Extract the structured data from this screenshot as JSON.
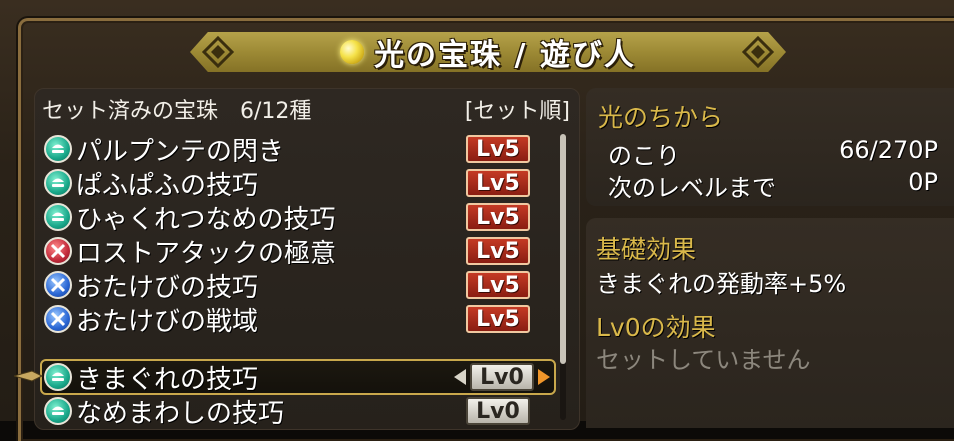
{
  "header": {
    "title": "光の宝珠 / 遊び人",
    "icon": "light-orb-icon"
  },
  "list": {
    "heading": "セット済みの宝珠　6/12種",
    "sort_label": "[セット順]",
    "rows": [
      {
        "name": "パルプンテの閃き",
        "level": "Lv5",
        "gem": "green",
        "icon": "green-gem-icon"
      },
      {
        "name": "ぱふぱふの技巧",
        "level": "Lv5",
        "gem": "green",
        "icon": "green-gem-icon"
      },
      {
        "name": "ひゃくれつなめの技巧",
        "level": "Lv5",
        "gem": "green",
        "icon": "green-gem-icon"
      },
      {
        "name": "ロストアタックの極意",
        "level": "Lv5",
        "gem": "red",
        "icon": "red-gem-icon"
      },
      {
        "name": "おたけびの技巧",
        "level": "Lv5",
        "gem": "blue",
        "icon": "blue-gem-icon"
      },
      {
        "name": "おたけびの戦域",
        "level": "Lv5",
        "gem": "blue",
        "icon": "blue-gem-icon"
      },
      {
        "name": "きまぐれの技巧",
        "level": "Lv0",
        "gem": "green",
        "icon": "green-gem-icon"
      },
      {
        "name": "なめまわしの技巧",
        "level": "Lv0",
        "gem": "green",
        "icon": "green-gem-icon"
      }
    ]
  },
  "power": {
    "title": "光のちから",
    "remaining_label": "のこり",
    "remaining_value": "66/270P",
    "next_label": "次のレベルまで",
    "next_value": "0P"
  },
  "effects": {
    "base_title": "基礎効果",
    "base_text": "きまぐれの発動率+5%",
    "level_title": "Lv0の効果",
    "level_text": "セットしていません"
  },
  "colors": {
    "accent_gold": "#d9b84a",
    "lv_red": "#c43a24",
    "header_band": "#9d8a35"
  }
}
